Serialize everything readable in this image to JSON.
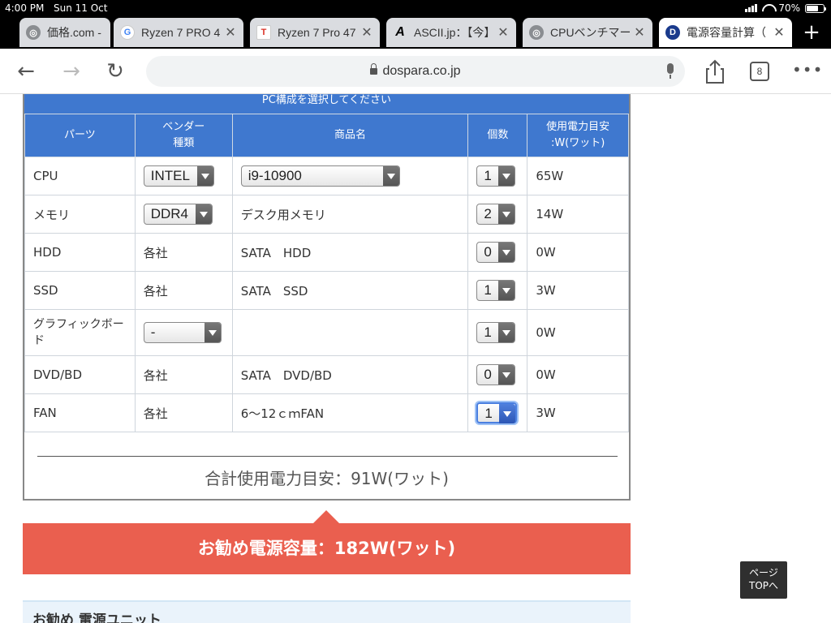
{
  "status_bar": {
    "time": "4:00 PM",
    "date": "Sun 11 Oct",
    "battery": "70%",
    "battery_level": 0.7
  },
  "tabs": [
    {
      "title": "価格.com - ",
      "favicon": "globe-icon"
    },
    {
      "title": "Ryzen 7 PRO 4",
      "favicon": "google-icon"
    },
    {
      "title": "Ryzen 7 Pro 47",
      "favicon": "t-icon"
    },
    {
      "title": "ASCII.jp：【今】",
      "favicon": "ascii-icon"
    },
    {
      "title": "CPUベンチマー",
      "favicon": "globe-icon"
    },
    {
      "title": "電源容量計算（",
      "favicon": "dospara-icon",
      "active": true
    }
  ],
  "toolbar": {
    "url": "dospara.co.jp",
    "tab_count": "8"
  },
  "calculator": {
    "caption": "PC構成を選択してください",
    "headers": {
      "parts": "パーツ",
      "vendor_line1": "ベンダー",
      "vendor_line2": "種類",
      "product": "商品名",
      "count": "個数",
      "power_line1": "使用電力目安",
      "power_line2": ":W(ワット)"
    },
    "rows": [
      {
        "part": "CPU",
        "vendor": "INTEL",
        "vendor_select": true,
        "product": "i9-10900",
        "product_select": true,
        "count": "1",
        "power": "65W"
      },
      {
        "part": "メモリ",
        "vendor": "DDR4",
        "vendor_select": true,
        "product": "デスク用メモリ",
        "count": "2",
        "power": "14W"
      },
      {
        "part": "HDD",
        "vendor": "各社",
        "product": "SATA　HDD",
        "count": "0",
        "power": "0W"
      },
      {
        "part": "SSD",
        "vendor": "各社",
        "product": "SATA　SSD",
        "count": "1",
        "power": "3W"
      },
      {
        "part": "グラフィックボード",
        "vendor": "-",
        "vendor_select": true,
        "product": "",
        "count": "1",
        "power": "0W"
      },
      {
        "part": "DVD/BD",
        "vendor": "各社",
        "product": "SATA　DVD/BD",
        "count": "0",
        "power": "0W"
      },
      {
        "part": "FAN",
        "vendor": "各社",
        "product": "6〜12ｃｍFAN",
        "count": "1",
        "power": "3W",
        "focused": true
      }
    ],
    "total": "合計使用電力目安：91W(ワット)"
  },
  "recommendation": "お勧め電源容量：182W(ワット)",
  "psu_section": "お勧め 電源ユニット",
  "page_top": {
    "line1": "ページ",
    "line2": "TOPへ"
  },
  "colors": {
    "header_blue": "#3f78cf",
    "recommend_red": "#ea5f4f",
    "psu_bg": "#eaf3fb"
  }
}
